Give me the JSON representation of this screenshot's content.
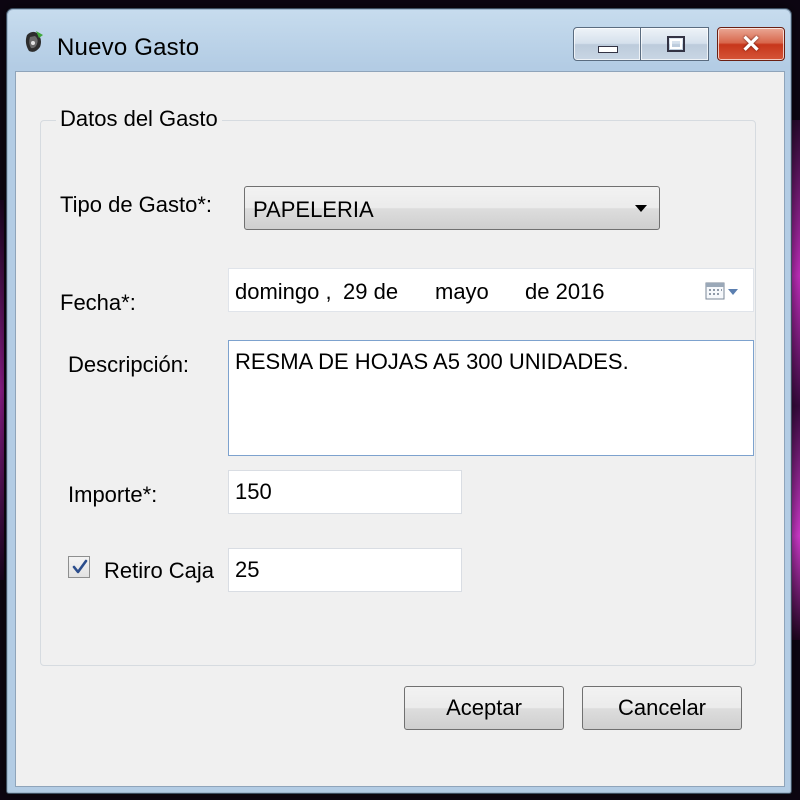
{
  "window": {
    "title": "Nuevo Gasto"
  },
  "group": {
    "legend": "Datos del Gasto"
  },
  "form": {
    "tipo_label": "Tipo de Gasto*:",
    "tipo_value": "PAPELERIA",
    "fecha_label": "Fecha*:",
    "fecha": {
      "weekday": "domingo ,",
      "day": "29 de",
      "month": "mayo",
      "year": "de 2016"
    },
    "descripcion_label": "Descripción:",
    "descripcion_value": "RESMA DE HOJAS A5 300 UNIDADES.",
    "importe_label": "Importe*:",
    "importe_value": "150",
    "retiro_label": "Retiro Caja",
    "retiro_checked": true,
    "retiro_value": "25"
  },
  "buttons": {
    "accept": "Aceptar",
    "cancel": "Cancelar"
  },
  "icons": {
    "app": "app-icon",
    "minimize": "minimize-icon",
    "maximize": "maximize-icon",
    "close": "close-icon",
    "dropdown": "chevron-down-icon",
    "calendar": "calendar-icon",
    "checkmark": "checkmark-icon"
  },
  "colors": {
    "close_button": "#c7361b",
    "title_bar": "#b3cce4",
    "client_bg": "#f0f0f0"
  }
}
